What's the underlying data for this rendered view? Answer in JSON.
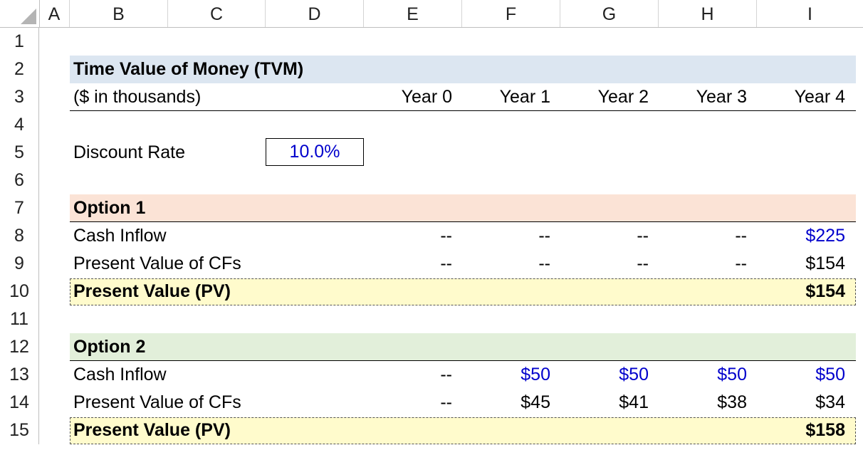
{
  "columns": [
    "A",
    "B",
    "C",
    "D",
    "E",
    "F",
    "G",
    "H",
    "I"
  ],
  "rows": [
    "1",
    "2",
    "3",
    "4",
    "5",
    "6",
    "7",
    "8",
    "9",
    "10",
    "11",
    "12",
    "13",
    "14",
    "15"
  ],
  "title": "Time Value of Money (TVM)",
  "units": "($ in thousands)",
  "years": [
    "Year 0",
    "Year 1",
    "Year 2",
    "Year 3",
    "Year 4"
  ],
  "discount": {
    "label": "Discount Rate",
    "value": "10.0%"
  },
  "option1": {
    "header": "Option 1",
    "cash_inflow_label": "Cash Inflow",
    "cash_inflow": [
      "--",
      "--",
      "--",
      "--",
      "$225"
    ],
    "pv_cfs_label": "Present Value of CFs",
    "pv_cfs": [
      "--",
      "--",
      "--",
      "--",
      "$154"
    ],
    "pv_label": "Present Value (PV)",
    "pv_value": "$154"
  },
  "option2": {
    "header": "Option 2",
    "cash_inflow_label": "Cash Inflow",
    "cash_inflow": [
      "--",
      "$50",
      "$50",
      "$50",
      "$50"
    ],
    "pv_cfs_label": "Present Value of CFs",
    "pv_cfs": [
      "--",
      "$45",
      "$41",
      "$38",
      "$34"
    ],
    "pv_label": "Present Value (PV)",
    "pv_value": "$158"
  },
  "colors": {
    "title_band": "#dce6f1",
    "option1_band": "#fbe3d6",
    "option2_band": "#e2efda",
    "pv_band": "#fffbcc",
    "input_blue": "#0000cc"
  }
}
